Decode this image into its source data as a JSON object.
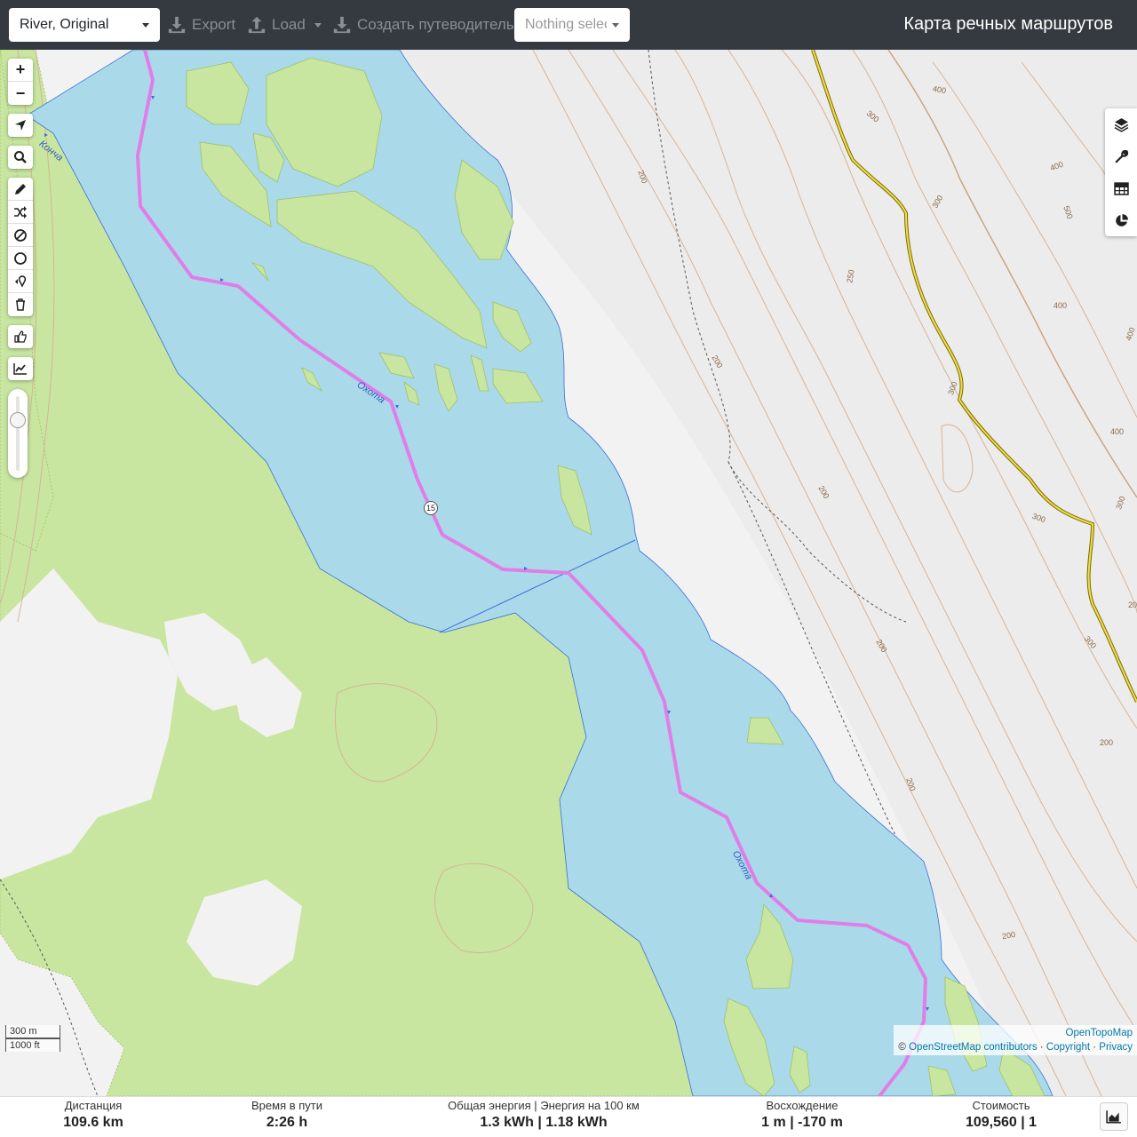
{
  "topbar": {
    "profile": "River, Original",
    "export_label": "Export",
    "load_label": "Load",
    "guide_label": "Создать путеводитель",
    "selection_placeholder": "Nothing selected",
    "app_title": "Карта речных маршрутов"
  },
  "map": {
    "river_labels": [
      "Кончa",
      "Охота",
      "Охота"
    ],
    "route_marker": "15",
    "contour_labels": [
      "400",
      "300",
      "200",
      "400",
      "300",
      "500",
      "250",
      "400",
      "200",
      "200",
      "300",
      "200",
      "400",
      "400",
      "300",
      "300",
      "200",
      "200",
      "200",
      "200",
      "300"
    ],
    "colors": {
      "water": "#aadaea",
      "forest": "#c8e6a0",
      "route": "#e07ee8",
      "contour": "#d6b496",
      "road": "#c8b400"
    }
  },
  "controls": {
    "zoom_in": "+",
    "zoom_out": "−"
  },
  "scale": {
    "metric": "300 m",
    "imperial": "1000 ft"
  },
  "attribution": {
    "line1": "OpenTopoMap",
    "prefix": "©",
    "osm": "OpenStreetMap contributors",
    "copyright": "Copyright",
    "privacy": "Privacy"
  },
  "stats": {
    "distance_label": "Дистанция",
    "distance_value": "109.6 km",
    "time_label": "Время в пути",
    "time_value": "2:26 h",
    "energy_label": "Общая энергия | Энергия на 100 км",
    "energy_value": "1.3 kWh | 1.18 kWh",
    "ascent_label": "Восхождение",
    "ascent_value": "1 m | -170 m",
    "cost_label": "Стоимость",
    "cost_value": "109,560 | 1"
  }
}
